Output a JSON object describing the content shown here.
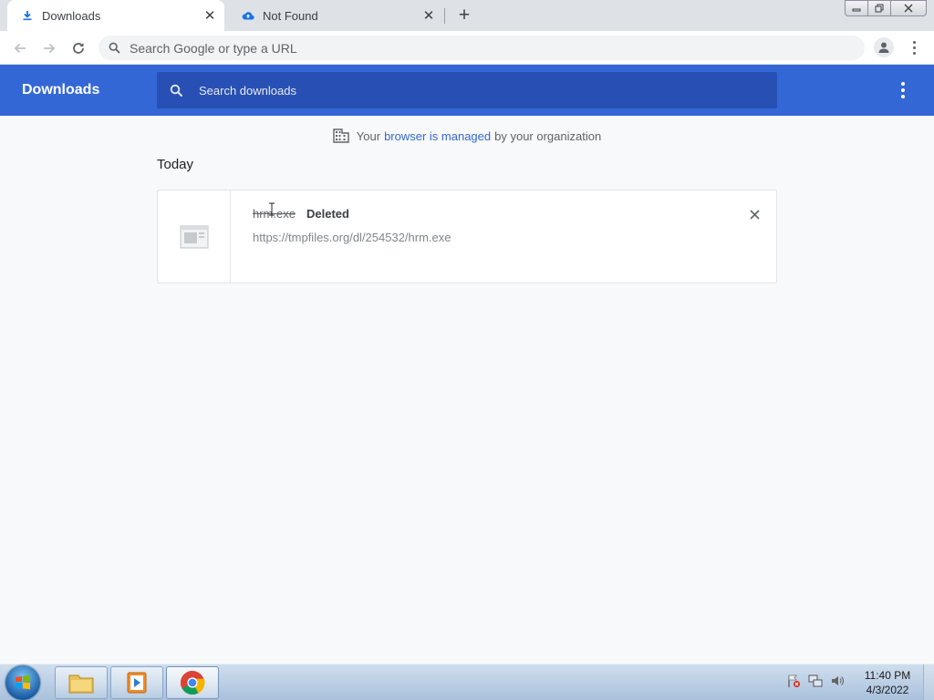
{
  "tabs": [
    {
      "title": "Downloads",
      "icon": "download-icon",
      "active": true
    },
    {
      "title": "Not Found",
      "icon": "cloud-icon",
      "active": false
    }
  ],
  "window_controls": {
    "minimize": "▭",
    "restore": "❐",
    "close": "✕"
  },
  "toolbar": {
    "omnibox_placeholder": "Search Google or type a URL"
  },
  "downloads_page": {
    "title": "Downloads",
    "search_placeholder": "Search downloads",
    "managed_prefix": "Your",
    "managed_link": "browser is managed",
    "managed_suffix": "by your organization",
    "section_date": "Today",
    "items": [
      {
        "filename": "hrm.exe",
        "status": "Deleted",
        "url": "https://tmpfiles.org/dl/254532/hrm.exe"
      }
    ]
  },
  "taskbar": {
    "time": "11:40 PM",
    "date": "4/3/2022"
  },
  "colors": {
    "header_blue": "#3367d6",
    "search_blue": "#2850b4",
    "link_blue": "#3367d6"
  }
}
